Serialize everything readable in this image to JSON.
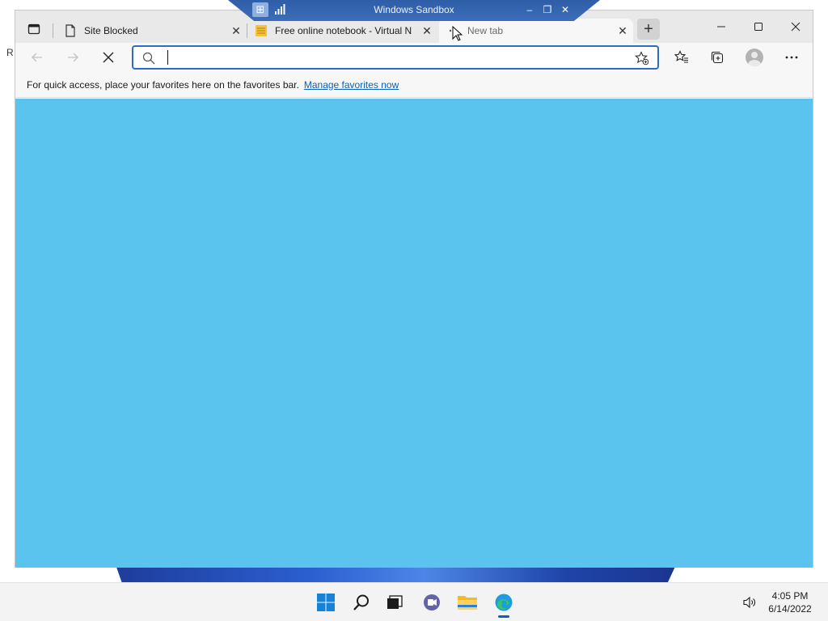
{
  "sandbox": {
    "title": "Windows Sandbox"
  },
  "desktop": {
    "edge_text": "R"
  },
  "browser": {
    "tabs": [
      {
        "label": "Site Blocked",
        "icon": "page-icon",
        "active": false
      },
      {
        "label": "Free online notebook - Virtual N",
        "icon": "notebook-icon",
        "active": false
      },
      {
        "label": "New tab",
        "icon": "loading-dot-icon",
        "active": true
      }
    ],
    "new_tab_label": "+",
    "address_bar": {
      "value": "",
      "placeholder": ""
    },
    "favorites_bar": {
      "message": "For quick access, place your favorites here on the favorites bar.",
      "link": "Manage favorites now"
    },
    "content_color": "#5bc4ee"
  },
  "taskbar": {
    "apps": [
      "start-icon",
      "search-icon",
      "task-view-icon",
      "chat-icon",
      "file-explorer-icon",
      "edge-icon"
    ],
    "clock": {
      "time": "4:05 PM",
      "date": "6/14/2022"
    }
  },
  "colors": {
    "accent": "#2d6cc0",
    "link": "#0a5fb8",
    "sandbox_bar": "#3563ad"
  }
}
